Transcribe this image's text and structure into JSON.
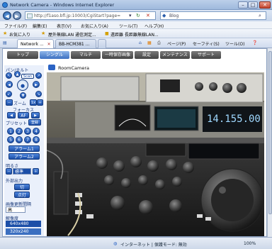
{
  "window": {
    "title": "Network Camera - Windows Internet Explorer"
  },
  "address": {
    "url": "http://f1aso.bfl.jp:10003/CgiStart?page=",
    "search_value": "Blog"
  },
  "menubar": {
    "items": [
      "ファイル(F)",
      "編集(E)",
      "表示(V)",
      "お気に入り(A)",
      "ツール(T)",
      "ヘルプ(H)"
    ]
  },
  "favorites": {
    "label": "お気に入り",
    "items": [
      "屋外無線LAN 通信測定...",
      "遠距離 長距離無線LAN..."
    ]
  },
  "browser_tabs": [
    "Network ...",
    "BB-HCM381 ..."
  ],
  "tools": {
    "page": "ページ(P)",
    "safety": "セーフティ(S)",
    "tools": "ツール(O)"
  },
  "page_nav": [
    "トップ",
    "シングル",
    "マルチ",
    "一時保存画像",
    "設定",
    "メンテナンス",
    "サポート"
  ],
  "camera": {
    "name": "RoomCamera"
  },
  "sidebar": {
    "pantilt_label": "パン/チルト",
    "scan_label": "Scan",
    "zoom_label": "ズーム",
    "zoom_value": "1x",
    "focus_label": "フォーカス",
    "focus_af": "AF",
    "preset_label": "プリセット",
    "preset_register": "登録",
    "presets": [
      "1",
      "2",
      "3",
      "4",
      "5",
      "6",
      "7",
      "8"
    ],
    "alarm1": "アラーム1",
    "alarm2": "アラーム2",
    "brightness_label": "明るさ",
    "brightness_value": "標準",
    "output_label": "外部出力",
    "output_off": "切",
    "output_on": "点灯",
    "interval_label": "画像更新間隔",
    "interval_value": "高",
    "resolution_label": "解像度",
    "res_640": "640x480",
    "res_320": "320x240"
  },
  "radio_display": {
    "freq": "14.155.00"
  },
  "status": {
    "zone": "インターネット | 保護モード: 無効",
    "zoom": "100%"
  },
  "colors": {
    "accent": "#2b63c4",
    "tab_active": "#3b6fc0"
  }
}
